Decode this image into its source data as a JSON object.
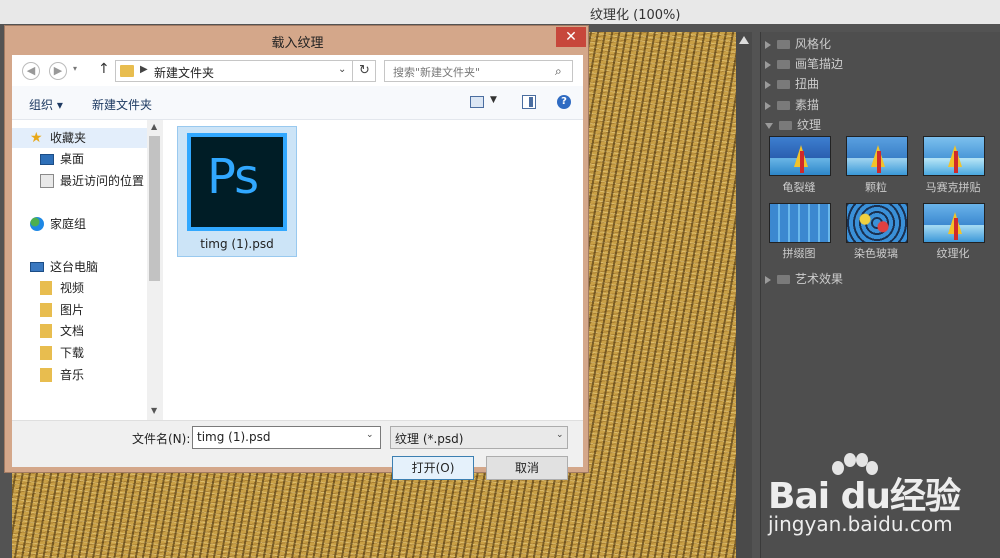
{
  "ps": {
    "title": "纹理化 (100%)",
    "categories": [
      {
        "label": "风格化",
        "open": false
      },
      {
        "label": "画笔描边",
        "open": false
      },
      {
        "label": "扭曲",
        "open": false
      },
      {
        "label": "素描",
        "open": false
      },
      {
        "label": "纹理",
        "open": true
      },
      {
        "label": "艺术效果",
        "open": false
      }
    ],
    "textures": [
      "龟裂缝",
      "颗粒",
      "马赛克拼贴",
      "拼缀图",
      "染色玻璃",
      "纹理化"
    ]
  },
  "dialog": {
    "title": "载入纹理",
    "close_glyph": "✕",
    "address": "新建文件夹",
    "search_placeholder": "搜索\"新建文件夹\"",
    "organize": "组织 ▾",
    "new_folder": "新建文件夹",
    "nav": {
      "favorites": "收藏夹",
      "desktop": "桌面",
      "recent": "最近访问的位置",
      "homegroup": "家庭组",
      "this_pc": "这台电脑",
      "videos": "视频",
      "pictures": "图片",
      "documents": "文档",
      "downloads": "下载",
      "music": "音乐"
    },
    "file": {
      "name": "timg (1).psd",
      "icon_text": "Ps"
    },
    "filename_label": "文件名(N):",
    "filename_value": "timg (1).psd",
    "filetype": "纹理 (*.psd)",
    "open_label": "打开(O)",
    "cancel_label": "取消"
  },
  "watermark": {
    "brand": "Bai du经验",
    "url": "jingyan.baidu.com"
  }
}
